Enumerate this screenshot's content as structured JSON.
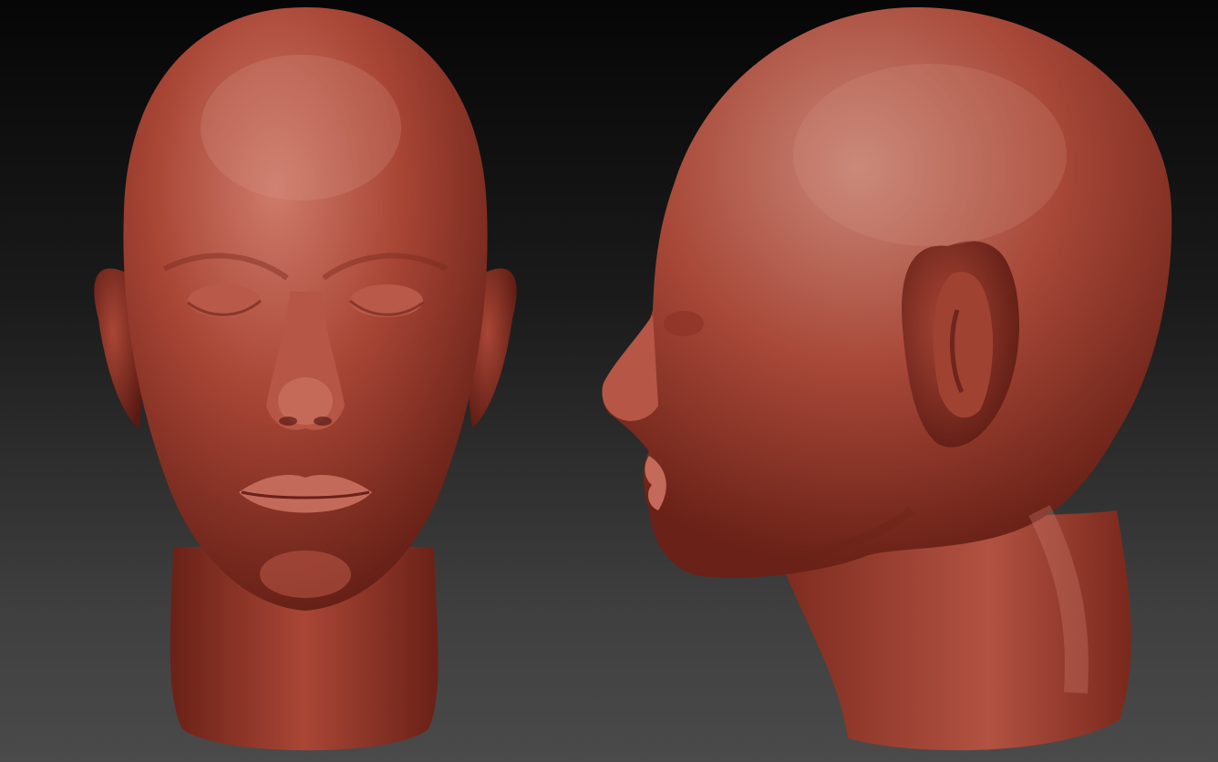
{
  "viewport": {
    "background_top": "#060606",
    "background_bottom": "#4a4a4a"
  },
  "material": {
    "base_color": "#a94636",
    "highlight_color": "#d58474",
    "shadow_color": "#5a1a12"
  },
  "models": [
    {
      "id": "head-front",
      "view": "front"
    },
    {
      "id": "head-side",
      "view": "profile-left"
    }
  ]
}
